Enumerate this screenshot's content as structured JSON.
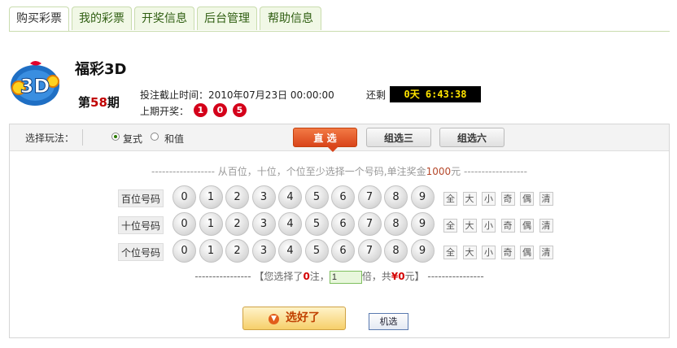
{
  "tabs": [
    {
      "label": "购买彩票",
      "active": true
    },
    {
      "label": "我的彩票",
      "active": false
    },
    {
      "label": "开奖信息",
      "active": false
    },
    {
      "label": "后台管理",
      "active": false
    },
    {
      "label": "帮助信息",
      "active": false
    }
  ],
  "header": {
    "logo_text": "3D",
    "title": "福彩3D",
    "issue_prefix": "第",
    "issue_number": "58",
    "issue_suffix": "期",
    "deadline": "投注截止时间：2010年07月23日 00:00:00",
    "remaining_label": "还剩",
    "countdown": "0天 6:43:38",
    "last_draw_label": "上期开奖：",
    "last_draw_numbers": [
      "1",
      "0",
      "5"
    ]
  },
  "play": {
    "select_label": "选择玩法：",
    "options": [
      {
        "label": "复式",
        "checked": true
      },
      {
        "label": "和值",
        "checked": false
      }
    ],
    "types": [
      {
        "label": "直 选",
        "active": true
      },
      {
        "label": "组选三",
        "active": false
      },
      {
        "label": "组选六",
        "active": false
      }
    ],
    "hint_prefix": "------------------ 从百位，十位，个位至少选择一个号码,单注奖金",
    "hint_amount": "1000",
    "hint_suffix": "元 ------------------",
    "rows": [
      {
        "label": "百位号码"
      },
      {
        "label": "十位号码"
      },
      {
        "label": "个位号码"
      }
    ],
    "digits": [
      "0",
      "1",
      "2",
      "3",
      "4",
      "5",
      "6",
      "7",
      "8",
      "9"
    ],
    "quick_buttons": [
      "全",
      "大",
      "小",
      "奇",
      "偶",
      "清"
    ],
    "summary": {
      "dashes_left": "----------------",
      "part1": "【您选择了",
      "count": "0",
      "part2": "注，",
      "multiplier": "1",
      "part3": "倍，共",
      "currency": "¥",
      "total": "0",
      "part4": "元】",
      "dashes_right": "----------------"
    },
    "confirm_label": "选好了",
    "random_label": "机选"
  },
  "colors": {
    "accent_red": "#d4001a",
    "tab_green": "#2f5e11",
    "active_orange": "#d9441a",
    "countdown_text": "#ffe400"
  }
}
